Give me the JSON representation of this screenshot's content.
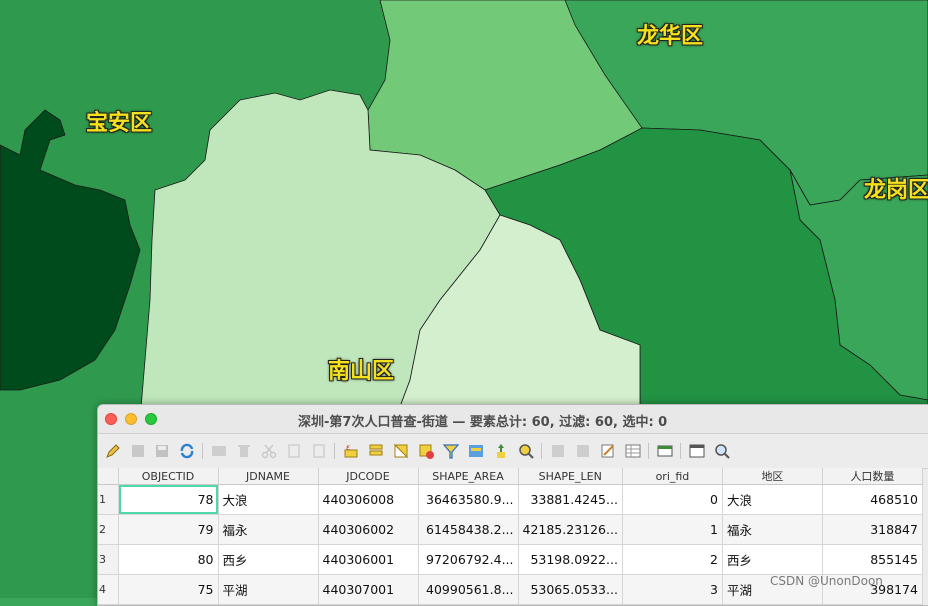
{
  "map": {
    "districts": [
      {
        "name": "宝安区",
        "color": "#2f9a4e"
      },
      {
        "name": "龙华区",
        "color": "#3aa65a"
      },
      {
        "name": "龙岗区",
        "color": "#3aa65a"
      },
      {
        "name": "南山区",
        "color": "#bfe7bb"
      }
    ],
    "colors": {
      "darkest": "#004b1b",
      "dark": "#229243",
      "mid": "#3aa65a",
      "light": "#72c978",
      "lighter": "#bfe7bb",
      "lightest": "#d3efce",
      "outline": "#1a1a1a",
      "label": "#f5e11d"
    }
  },
  "window": {
    "title": "深圳-第7次人口普查-街道 — 要素总计: 60, 过滤: 60, 选中: 0"
  },
  "toolbar": {
    "buttons": [
      "pencil-icon",
      "multi-edit-icon",
      "save-icon",
      "reload-icon",
      "add-feature-icon",
      "delete-icon",
      "cut-icon",
      "copy-icon",
      "paste-icon",
      "expression-select-icon",
      "select-all-icon",
      "invert-selection-icon",
      "deselect-icon",
      "filter-icon",
      "move-selection-top-icon",
      "pan-to-selected-icon",
      "zoom-to-selected-icon",
      "new-field-icon",
      "delete-field-icon",
      "field-calculator-icon",
      "conditional-format-icon",
      "dock-icon",
      "actions-icon",
      "form-view-icon",
      "table-view-icon"
    ]
  },
  "table": {
    "columns": [
      "OBJECTID",
      "JDNAME",
      "JDCODE",
      "SHAPE_AREA",
      "SHAPE_LEN",
      "ori_fid",
      "地区",
      "人口数量"
    ],
    "rows": [
      {
        "n": "1",
        "cells": [
          "78",
          "大浪",
          "440306008",
          "36463580.9...",
          "33881.4245...",
          "0",
          "大浪",
          "468510"
        ]
      },
      {
        "n": "2",
        "cells": [
          "79",
          "福永",
          "440306002",
          "61458438.2...",
          "42185.23126...",
          "1",
          "福永",
          "318847"
        ]
      },
      {
        "n": "3",
        "cells": [
          "80",
          "西乡",
          "440306001",
          "97206792.4...",
          "53198.0922...",
          "2",
          "西乡",
          "855145"
        ]
      },
      {
        "n": "4",
        "cells": [
          "75",
          "平湖",
          "440307001",
          "40990561.8...",
          "53065.0533...",
          "3",
          "平湖",
          "398174"
        ]
      }
    ]
  },
  "watermark": "CSDN @UnonDoon"
}
